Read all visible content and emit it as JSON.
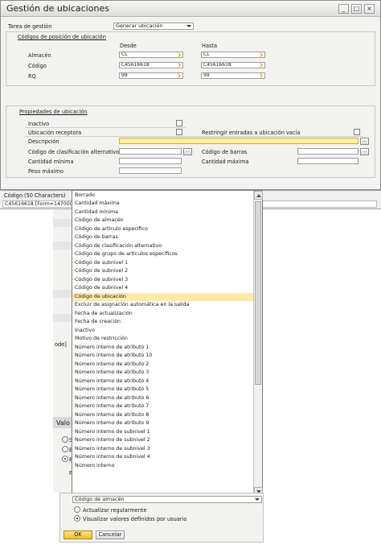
{
  "window": {
    "title": "Gestión de ubicaciones",
    "minimize_glyph": "_",
    "maximize_glyph": "□",
    "close_glyph": "×"
  },
  "task": {
    "label": "Tarea de gestión",
    "value": "Generar ubicación"
  },
  "position_codes": {
    "section_title": "Códigos de posición de ubicación",
    "from_header": "Desde",
    "to_header": "Hasta",
    "rows": [
      {
        "label": "Almacén",
        "from": "CL",
        "to": "CL"
      },
      {
        "label": "Código",
        "from": "C45616618",
        "to": "C45616618"
      },
      {
        "label": "RQ",
        "from": "99",
        "to": "99"
      }
    ]
  },
  "properties": {
    "section_title": "Propiedades de ubicación",
    "inactive_label": "Inactivo",
    "receiving_label": "Ubicación receptora",
    "restrict_label": "Restringir entradas a ubicación vacía",
    "description_label": "Descripción",
    "description_value": "",
    "alt_sort_label": "Código de clasificación alternativo",
    "barcode_label": "Código de barras",
    "min_qty_label": "Cantidad mínima",
    "max_qty_label": "Cantidad máxima",
    "max_weight_label": "Peso máximo",
    "ellipsis": "..."
  },
  "status": {
    "field_title": "Código (50 Characters)",
    "info": "C45616618 [Form=1470000003 Item=1470000014 Pane=0 OBSL,SLCode]"
  },
  "background_dialog": {
    "code_frag": "ode]",
    "title_frag": "Valo",
    "radio_s": "S",
    "radio_b1": "B",
    "radio_b2": "B",
    "p_frag": "P"
  },
  "dropdown": {
    "selected_index": 12,
    "items": [
      "Borrado",
      "Cantidad máxima",
      "Cantidad mínima",
      "Código de almacén",
      "Código de artículo específico",
      "Código de barras",
      "Código de clasificación alternativo",
      "Código de grupo de artículos específicos",
      "Código de subnivel 1",
      "Código de subnivel 2",
      "Código de subnivel 3",
      "Código de subnivel 4",
      "Código de ubicación",
      "Excluir de asignación automática en la salida",
      "Fecha de actualización",
      "Fecha de creación",
      "Inactivo",
      "Motivo de restricción",
      "Número interno de atributo 1",
      "Número interno de atributo 10",
      "Número interno de atributo 2",
      "Número interno de atributo 3",
      "Número interno de atributo 4",
      "Número interno de atributo 5",
      "Número interno de atributo 6",
      "Número interno de atributo 7",
      "Número interno de atributo 8",
      "Número interno de atributo 9",
      "Número interno de subnivel 1",
      "Número interno de subnivel 2",
      "Número interno de subnivel 3",
      "Número interno de subnivel 4",
      "Número interno"
    ],
    "current_value": "Código de almacén"
  },
  "dialog": {
    "radio_update": "Actualizar regularmente",
    "radio_user": "Visualizar valores definidos por usuario",
    "selected_radio": "user",
    "ok_label": "OK",
    "cancel_label": "Cancelar"
  },
  "colors": {
    "accent": "#f3bd2a",
    "selection": "#fce8a8",
    "field_highlight": "#fcefa4"
  }
}
